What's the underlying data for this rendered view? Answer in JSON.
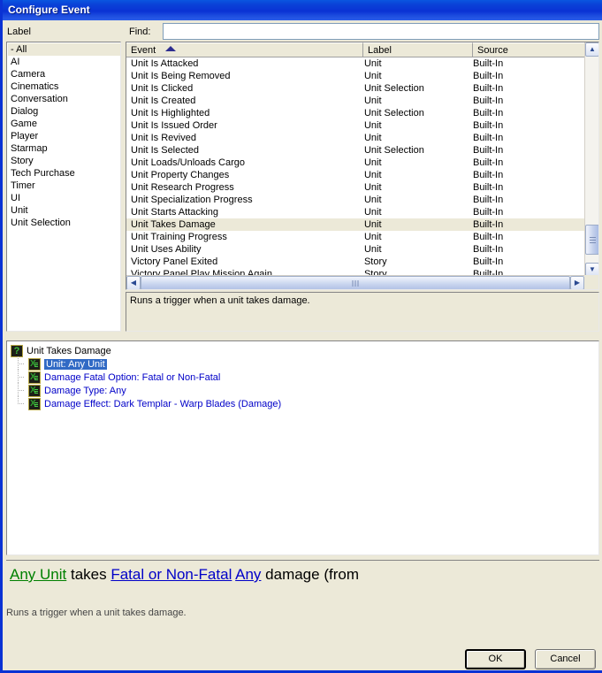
{
  "window": {
    "title": "Configure Event"
  },
  "left": {
    "caption": "Label",
    "categories": [
      {
        "label": "- All",
        "selected": true
      },
      {
        "label": "AI",
        "selected": false
      },
      {
        "label": "Camera",
        "selected": false
      },
      {
        "label": "Cinematics",
        "selected": false
      },
      {
        "label": "Conversation",
        "selected": false
      },
      {
        "label": "Dialog",
        "selected": false
      },
      {
        "label": "Game",
        "selected": false
      },
      {
        "label": "Player",
        "selected": false
      },
      {
        "label": "Starmap",
        "selected": false
      },
      {
        "label": "Story",
        "selected": false
      },
      {
        "label": "Tech Purchase",
        "selected": false
      },
      {
        "label": "Timer",
        "selected": false
      },
      {
        "label": "UI",
        "selected": false
      },
      {
        "label": "Unit",
        "selected": false
      },
      {
        "label": "Unit Selection",
        "selected": false
      }
    ]
  },
  "find": {
    "caption": "Find:",
    "value": "",
    "placeholder": ""
  },
  "event_list": {
    "columns": [
      "Event",
      "Label",
      "Source"
    ],
    "sorted_column": "Event",
    "sort_direction": "ascending",
    "rows": [
      {
        "event": "Unit Is Attacked",
        "label": "Unit",
        "source": "Built-In",
        "selected": false
      },
      {
        "event": "Unit Is Being Removed",
        "label": "Unit",
        "source": "Built-In",
        "selected": false
      },
      {
        "event": "Unit Is Clicked",
        "label": "Unit Selection",
        "source": "Built-In",
        "selected": false
      },
      {
        "event": "Unit Is Created",
        "label": "Unit",
        "source": "Built-In",
        "selected": false
      },
      {
        "event": "Unit Is Highlighted",
        "label": "Unit Selection",
        "source": "Built-In",
        "selected": false
      },
      {
        "event": "Unit Is Issued Order",
        "label": "Unit",
        "source": "Built-In",
        "selected": false
      },
      {
        "event": "Unit Is Revived",
        "label": "Unit",
        "source": "Built-In",
        "selected": false
      },
      {
        "event": "Unit Is Selected",
        "label": "Unit Selection",
        "source": "Built-In",
        "selected": false
      },
      {
        "event": "Unit Loads/Unloads Cargo",
        "label": "Unit",
        "source": "Built-In",
        "selected": false
      },
      {
        "event": "Unit Property Changes",
        "label": "Unit",
        "source": "Built-In",
        "selected": false
      },
      {
        "event": "Unit Research Progress",
        "label": "Unit",
        "source": "Built-In",
        "selected": false
      },
      {
        "event": "Unit Specialization Progress",
        "label": "Unit",
        "source": "Built-In",
        "selected": false
      },
      {
        "event": "Unit Starts Attacking",
        "label": "Unit",
        "source": "Built-In",
        "selected": false
      },
      {
        "event": "Unit Takes Damage",
        "label": "Unit",
        "source": "Built-In",
        "selected": true
      },
      {
        "event": "Unit Training Progress",
        "label": "Unit",
        "source": "Built-In",
        "selected": false
      },
      {
        "event": "Unit Uses Ability",
        "label": "Unit",
        "source": "Built-In",
        "selected": false
      },
      {
        "event": "Victory Panel Exited",
        "label": "Story",
        "source": "Built-In",
        "selected": false
      },
      {
        "event": "Victory Panel Play Mission Again",
        "label": "Story",
        "source": "Built-In",
        "selected": false
      }
    ]
  },
  "event_description": "Runs a trigger when a unit takes damage.",
  "tree": {
    "root": {
      "label": "Unit Takes Damage",
      "icon": "event-question-icon"
    },
    "children": [
      {
        "label": "Unit: Any Unit",
        "icon": "variable-icon",
        "selected": true
      },
      {
        "label": "Damage Fatal Option: Fatal or Non-Fatal",
        "icon": "variable-icon",
        "selected": false
      },
      {
        "label": "Damage Type: Any",
        "icon": "variable-icon",
        "selected": false
      },
      {
        "label": "Damage Effect: Dark Templar - Warp Blades (Damage)",
        "icon": "variable-icon",
        "selected": false
      }
    ]
  },
  "preview": {
    "segments": [
      {
        "text": "Any Unit",
        "style": "green-link"
      },
      {
        "text": " takes ",
        "style": "plain"
      },
      {
        "text": "Fatal or Non-Fatal",
        "style": "blue-link"
      },
      {
        "text": " ",
        "style": "plain"
      },
      {
        "text": "Any",
        "style": "blue-link"
      },
      {
        "text": " damage (from",
        "style": "plain"
      }
    ]
  },
  "bottom_description": "Runs a trigger when a unit takes damage.",
  "buttons": {
    "ok": "OK",
    "cancel": "Cancel"
  },
  "colors": {
    "titlebar": "#0a32d4",
    "dialog_face": "#ece9d8",
    "selection_row": "#ece9d8",
    "tree_selection": "#316ac5",
    "green_link": "#008000",
    "blue_link": "#0000c8",
    "sort_arrow": "#2d2d8f"
  }
}
